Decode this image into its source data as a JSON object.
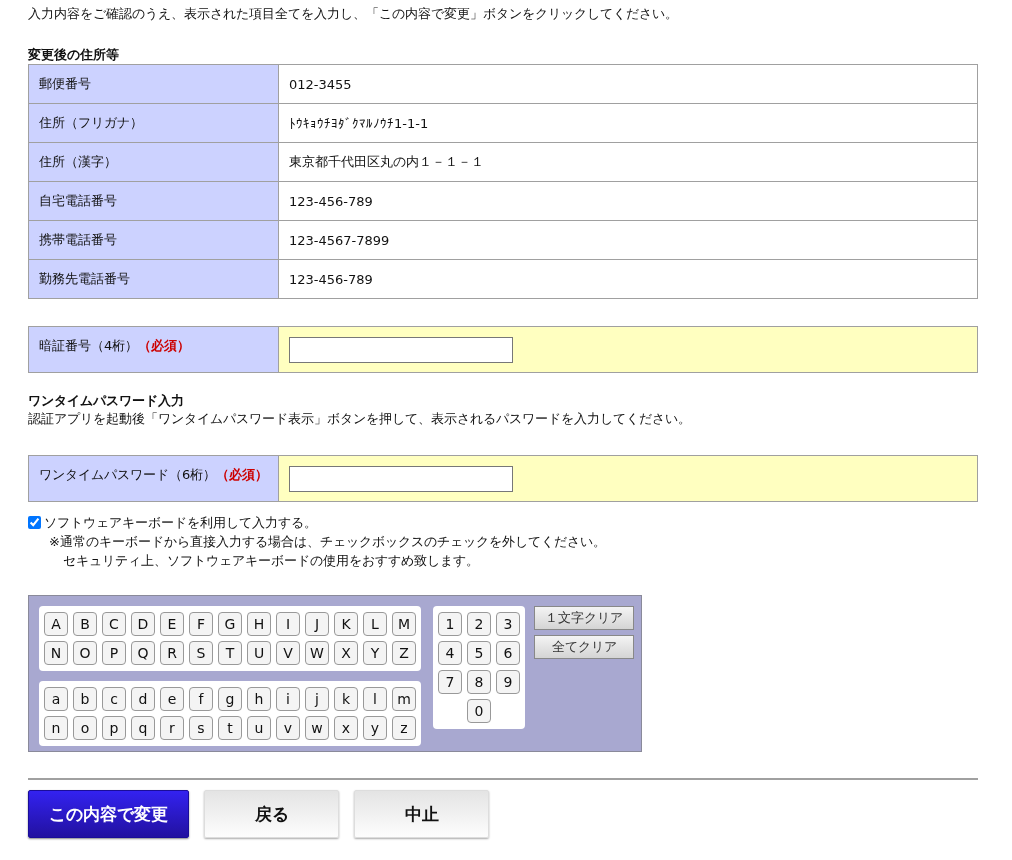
{
  "intro": "入力内容をご確認のうえ、表示された項目全てを入力し、「この内容で変更」ボタンをクリックしてください。",
  "address_section": {
    "heading": "変更後の住所等",
    "rows": [
      {
        "label": "郵便番号",
        "value": "012-3455"
      },
      {
        "label": "住所（フリガナ）",
        "value": "ﾄｳｷｮｳﾁﾖﾀﾞｸﾏﾙﾉｳﾁ1-1-1"
      },
      {
        "label": "住所（漢字）",
        "value": "東京都千代田区丸の内１－１－１"
      },
      {
        "label": "自宅電話番号",
        "value": "123-456-789"
      },
      {
        "label": "携帯電話番号",
        "value": "123-4567-7899"
      },
      {
        "label": "勤務先電話番号",
        "value": "123-456-789"
      }
    ]
  },
  "pin": {
    "label": "暗証番号（4桁）",
    "required": "（必須）"
  },
  "otp_section": {
    "heading": "ワンタイムパスワード入力",
    "description": "認証アプリを起動後「ワンタイムパスワード表示」ボタンを押して、表示されるパスワードを入力してください。"
  },
  "otp": {
    "label": "ワンタイムパスワード（6桁）",
    "required": "（必須）"
  },
  "software_keyboard": {
    "label": "ソフトウェアキーボードを利用して入力する。",
    "checked": true,
    "notes": [
      "※通常のキーボードから直接入力する場合は、チェックボックスのチェックを外してください。",
      "セキュリティ上、ソフトウェアキーボードの使用をおすすめ致します。"
    ]
  },
  "keyboard": {
    "upper_rows": [
      [
        "A",
        "B",
        "C",
        "D",
        "E",
        "F",
        "G",
        "H",
        "I",
        "J",
        "K",
        "L",
        "M"
      ],
      [
        "N",
        "O",
        "P",
        "Q",
        "R",
        "S",
        "T",
        "U",
        "V",
        "W",
        "X",
        "Y",
        "Z"
      ]
    ],
    "lower_rows": [
      [
        "a",
        "b",
        "c",
        "d",
        "e",
        "f",
        "g",
        "h",
        "i",
        "j",
        "k",
        "l",
        "m"
      ],
      [
        "n",
        "o",
        "p",
        "q",
        "r",
        "s",
        "t",
        "u",
        "v",
        "w",
        "x",
        "y",
        "z"
      ]
    ],
    "digit_rows": [
      [
        "1",
        "2",
        "3"
      ],
      [
        "4",
        "5",
        "6"
      ],
      [
        "7",
        "8",
        "9"
      ],
      [
        "0"
      ]
    ],
    "actions": [
      "１文字クリア",
      "全てクリア"
    ]
  },
  "buttons": [
    {
      "label": "この内容で変更",
      "kind": "primary"
    },
    {
      "label": "戻る",
      "kind": "secondary"
    },
    {
      "label": "中止",
      "kind": "secondary"
    }
  ]
}
